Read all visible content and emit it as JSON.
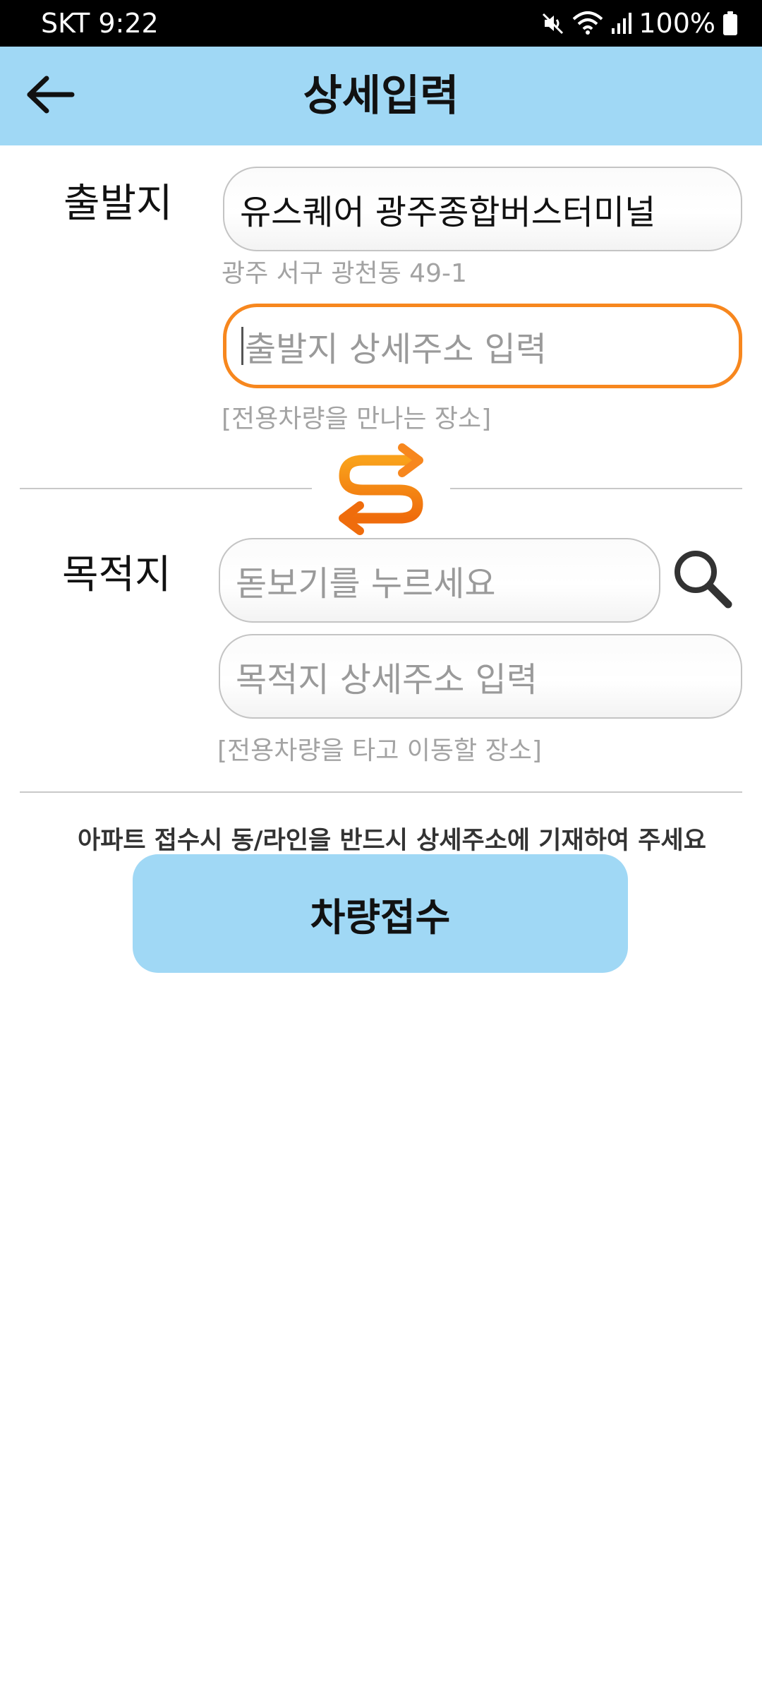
{
  "status_bar": {
    "carrier_time": "SKT 9:22",
    "battery": "100%",
    "icons": [
      "mute-icon",
      "wifi-icon",
      "signal-icon",
      "battery-icon"
    ]
  },
  "header": {
    "title": "상세입력",
    "back_icon": "arrow-left-icon",
    "background": "#a0d8f5"
  },
  "origin": {
    "label": "출발지",
    "name": "유스퀘어 광주종합버스터미널",
    "address": "광주 서구 광천동 49-1",
    "detail_placeholder": "출발지 상세주소 입력",
    "detail_hint": "[전용차량을 만나는 장소]",
    "focus_color": "#f7871e"
  },
  "swap": {
    "icon": "swap-icon"
  },
  "destination": {
    "label": "목적지",
    "search_placeholder": "돋보기를 누르세요",
    "search_icon": "search-icon",
    "detail_placeholder": "목적지 상세주소 입력",
    "detail_hint": "[전용차량을 타고 이동할 장소]"
  },
  "notice": "아파트 접수시 동/라인을 반드시 상세주소에 기재하여 주세요",
  "submit": {
    "label": "차량접수",
    "background": "#a0d8f5"
  }
}
